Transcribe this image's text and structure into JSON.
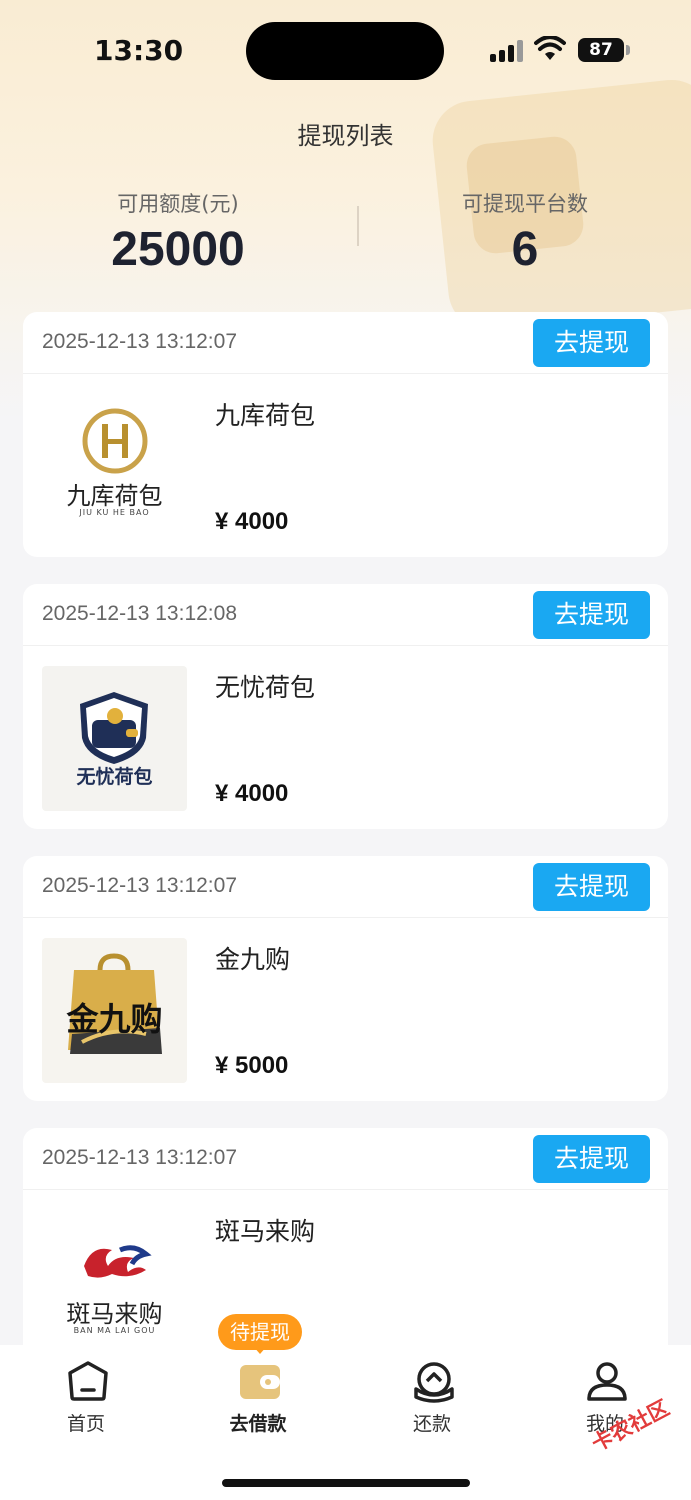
{
  "status_bar": {
    "time": "13:30",
    "battery": "87"
  },
  "header": {
    "title": "提现列表"
  },
  "stats": {
    "available_label": "可用额度(元)",
    "available_value": "25000",
    "platforms_label": "可提现平台数",
    "platforms_value": "6"
  },
  "cards": [
    {
      "date": "2025-12-13 13:12:07",
      "button": "去提现",
      "name": "九库荷包",
      "amount": "¥ 4000",
      "logo_text": "九库荷包",
      "logo_sub": "JIU KU HE BAO",
      "logo_mark": "H"
    },
    {
      "date": "2025-12-13 13:12:08",
      "button": "去提现",
      "name": "无忧荷包",
      "amount": "¥ 4000",
      "logo_text": "无忧荷包",
      "logo_mark": "$"
    },
    {
      "date": "2025-12-13 13:12:07",
      "button": "去提现",
      "name": "金九购",
      "amount": "¥ 5000",
      "logo_text": "金九购"
    },
    {
      "date": "2025-12-13 13:12:07",
      "button": "去提现",
      "name": "斑马来购",
      "amount": "",
      "logo_text": "斑马来购",
      "logo_sub": "BAN MA LAI GOU"
    }
  ],
  "tabbar": {
    "badge": "待提现",
    "items": [
      {
        "label": "首页",
        "icon": "home-icon"
      },
      {
        "label": "去借款",
        "icon": "wallet-icon"
      },
      {
        "label": "还款",
        "icon": "repay-icon"
      },
      {
        "label": "我的",
        "icon": "profile-icon"
      }
    ]
  },
  "watermark": "卡农社区",
  "colors": {
    "accent": "#1aa8f2",
    "badge": "#ff9a1a",
    "wallet": "#e6c47c"
  }
}
